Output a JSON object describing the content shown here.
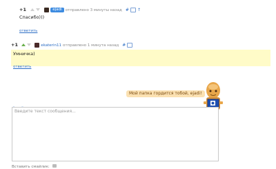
{
  "comment1": {
    "score": "+1",
    "username": "ejadi",
    "posted": "отправлено 3 минуты назад",
    "anchor": "#",
    "arrow": "↑",
    "text": "Спасибо)))",
    "reply": "ответить"
  },
  "comment2": {
    "score": "+1",
    "username": "ekaterin11",
    "posted": "отправлено 1 минута назад",
    "anchor": "#",
    "text": "Умничка)",
    "reply": "ответить"
  },
  "toolbar": {
    "btn1": "#",
    "btn2": "\"",
    "btn3": "∞"
  },
  "message": {
    "placeholder": "Введите текст сообщения..."
  },
  "mascot": {
    "bubble": "Мой папка гордится тобой, ejadi!"
  },
  "footer": {
    "text": "Вставить смайлик:"
  },
  "colors": {
    "accent": "#2a6cc4",
    "highlight": "#fffbc8",
    "bubble": "#fbe1b2",
    "badge": "#3d8be0"
  }
}
